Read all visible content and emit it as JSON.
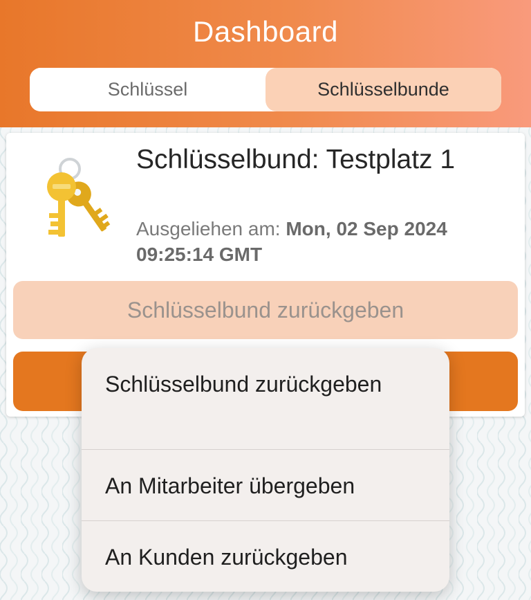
{
  "header": {
    "title": "Dashboard",
    "tabs": [
      {
        "label": "Schlüssel",
        "selected": false
      },
      {
        "label": "Schlüsselbunde",
        "selected": true
      }
    ]
  },
  "card": {
    "icon": "keys-icon",
    "title": "Schlüsselbund: Testplatz 1",
    "borrowed_label": "Ausgeliehen am:",
    "borrowed_value": "Mon, 02 Sep 2024 09:25:14 GMT",
    "return_button_label": "Schlüsselbund zurückgeben"
  },
  "menu": {
    "items": [
      {
        "label": "Schlüsselbund zurückgeben"
      },
      {
        "label": "An Mitarbeiter übergeben"
      },
      {
        "label": "An Kunden zurückgeben"
      }
    ]
  },
  "colors": {
    "accent": "#e4771f",
    "accent_light": "#f8d1b9",
    "header_start": "#e8772a",
    "header_end": "#f99a7c"
  }
}
